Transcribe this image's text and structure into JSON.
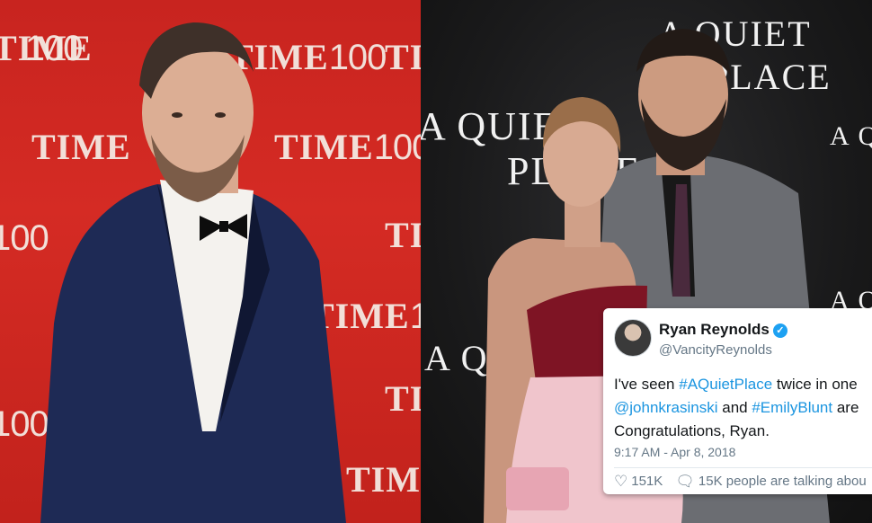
{
  "left_photo": {
    "backdrop_time": "TIME",
    "backdrop_num": "100"
  },
  "right_photo": {
    "backdrop_line1": "A QUIET",
    "backdrop_line2": "PLACE"
  },
  "tweet": {
    "name": "Ryan Reynolds",
    "verified_icon": "verified-badge-icon",
    "handle": "@VancityReynolds",
    "line1_prefix": "I've seen ",
    "line1_hashtag": "#AQuietPlace",
    "line1_suffix": " twice in one",
    "line2_mention": "@johnkrasinski",
    "line2_mid": " and ",
    "line2_hashtag": "#EmilyBlunt",
    "line2_suffix": " are",
    "line3": "Congratulations, Ryan.",
    "timestamp": "9:17 AM - Apr 8, 2018",
    "likes": "151K",
    "talking": "15K people are talking abou",
    "colors": {
      "link": "#1b95e0",
      "verified": "#1da1f2"
    }
  }
}
